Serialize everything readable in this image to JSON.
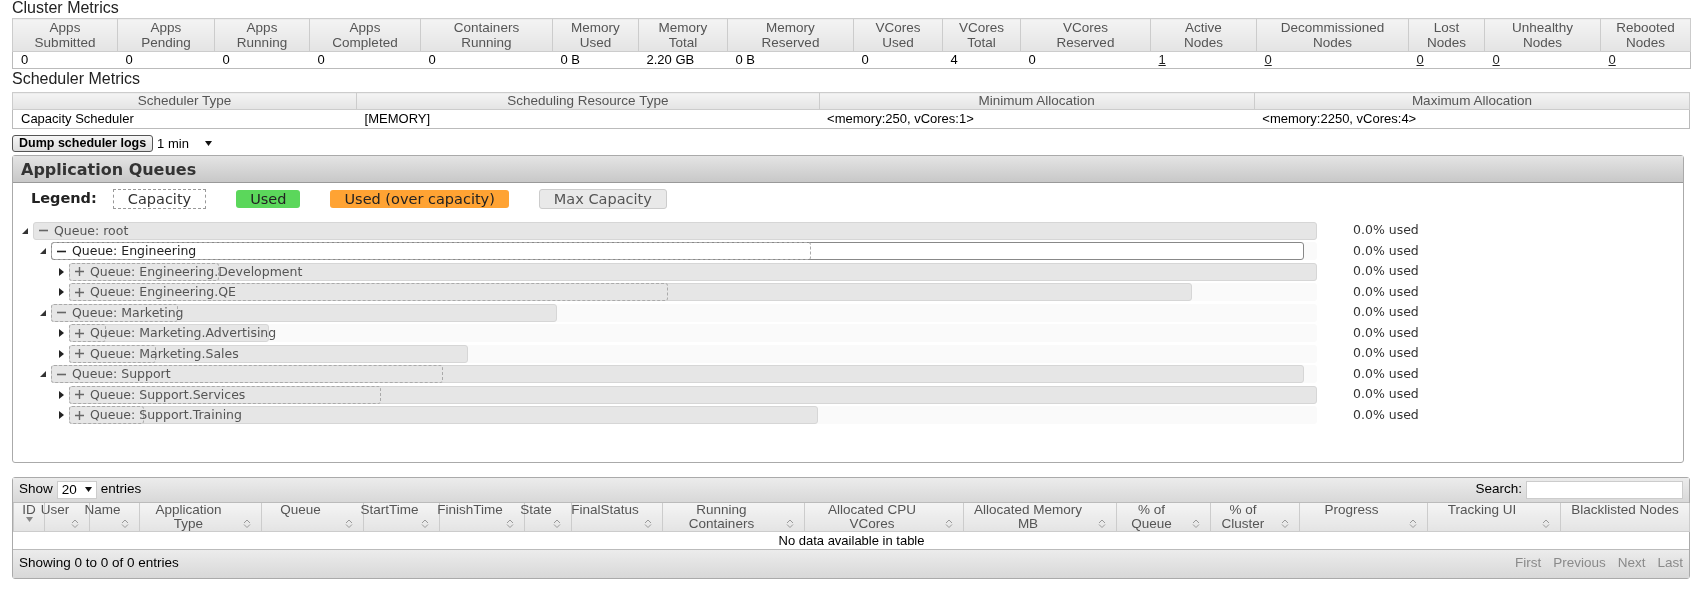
{
  "cluster_metrics": {
    "title": "Cluster Metrics",
    "columns": [
      {
        "label": "Apps Submitted",
        "value": "0",
        "link": false
      },
      {
        "label": "Apps Pending",
        "value": "0",
        "link": false
      },
      {
        "label": "Apps Running",
        "value": "0",
        "link": false
      },
      {
        "label": "Apps Completed",
        "value": "0",
        "link": false
      },
      {
        "label": "Containers Running",
        "value": "0",
        "link": false
      },
      {
        "label": "Memory Used",
        "value": "0 B",
        "link": false
      },
      {
        "label": "Memory Total",
        "value": "2.20 GB",
        "link": false
      },
      {
        "label": "Memory Reserved",
        "value": "0 B",
        "link": false
      },
      {
        "label": "VCores Used",
        "value": "0",
        "link": false
      },
      {
        "label": "VCores Total",
        "value": "4",
        "link": false
      },
      {
        "label": "VCores Reserved",
        "value": "0",
        "link": false
      },
      {
        "label": "Active Nodes",
        "value": "1",
        "link": true
      },
      {
        "label": "Decommissioned Nodes",
        "value": "0",
        "link": true
      },
      {
        "label": "Lost Nodes",
        "value": "0",
        "link": true
      },
      {
        "label": "Unhealthy Nodes",
        "value": "0",
        "link": true
      },
      {
        "label": "Rebooted Nodes",
        "value": "0",
        "link": true
      }
    ]
  },
  "scheduler_metrics": {
    "title": "Scheduler Metrics",
    "columns": [
      "Scheduler Type",
      "Scheduling Resource Type",
      "Minimum Allocation",
      "Maximum Allocation"
    ],
    "row": [
      "Capacity Scheduler",
      "[MEMORY]",
      "<memory:250, vCores:1>",
      "<memory:2250, vCores:4>"
    ]
  },
  "dump_button": "Dump scheduler logs",
  "dump_interval": "1 min",
  "application_queues": {
    "title": "Application Queues",
    "legend_label": "Legend:",
    "legend": [
      {
        "kind": "capacity",
        "label": "Capacity"
      },
      {
        "kind": "used",
        "label": "Used"
      },
      {
        "kind": "over",
        "label": "Used (over capacity)"
      },
      {
        "kind": "max",
        "label": "Max Capacity"
      }
    ],
    "queues": [
      {
        "label": "Queue: root",
        "usage": "0.0% used",
        "expanded": true,
        "selected": false,
        "max_capacity": {
          "level": 1.0
        },
        "children": [
          {
            "label": "Queue: Engineering",
            "usage": "0.0% used",
            "expanded": true,
            "selected": true,
            "max_capacity": {
              "level": 0.99
            },
            "capacity": {
              "level": 0.6
            },
            "children": [
              {
                "label": "Queue: Engineering.Development",
                "usage": "0.0% used",
                "expanded": false,
                "selected": false,
                "max_capacity": {
                  "level": 1.0
                },
                "capacity": {
                  "level": 0.12
                }
              },
              {
                "label": "Queue: Engineering.QE",
                "usage": "0.0% used",
                "expanded": false,
                "selected": false,
                "max_capacity": {
                  "level": 0.9
                },
                "capacity": {
                  "level": 0.48
                }
              }
            ]
          },
          {
            "label": "Queue: Marketing",
            "usage": "0.0% used",
            "expanded": true,
            "selected": false,
            "max_capacity": {
              "level": 0.4
            },
            "capacity": {
              "level": 0.1
            },
            "children": [
              {
                "label": "Queue: Marketing.Advertising",
                "usage": "0.0% used",
                "expanded": false,
                "selected": false,
                "max_capacity": {
                  "level": 0.16
                },
                "capacity": {
                  "level": 0.03
                }
              },
              {
                "label": "Queue: Marketing.Sales",
                "usage": "0.0% used",
                "expanded": false,
                "selected": false,
                "max_capacity": {
                  "level": 0.32
                },
                "capacity": {
                  "level": 0.07
                }
              }
            ]
          },
          {
            "label": "Queue: Support",
            "usage": "0.0% used",
            "expanded": true,
            "selected": false,
            "max_capacity": {
              "level": 0.99
            },
            "capacity": {
              "level": 0.31
            },
            "children": [
              {
                "label": "Queue: Support.Services",
                "usage": "0.0% used",
                "expanded": false,
                "selected": false,
                "max_capacity": {
                  "level": 1.0
                },
                "capacity": {
                  "level": 0.25
                }
              },
              {
                "label": "Queue: Support.Training",
                "usage": "0.0% used",
                "expanded": false,
                "selected": false,
                "max_capacity": {
                  "level": 0.6
                },
                "capacity": {
                  "level": 0.06
                }
              }
            ]
          }
        ]
      }
    ]
  },
  "applications": {
    "show_label": "Show",
    "page_size": "20",
    "entries_label": "entries",
    "search_label": "Search:",
    "columns": [
      {
        "label": "ID",
        "sortable": true,
        "sorted_descending": true
      },
      {
        "label": "User",
        "sortable": true,
        "sorted_descending": false
      },
      {
        "label": "Name",
        "sortable": true,
        "sorted_descending": false
      },
      {
        "label": "Application Type",
        "sortable": true,
        "sorted_descending": false
      },
      {
        "label": "Queue",
        "sortable": true,
        "sorted_descending": false
      },
      {
        "label": "StartTime",
        "sortable": true,
        "sorted_descending": false
      },
      {
        "label": "FinishTime",
        "sortable": true,
        "sorted_descending": false
      },
      {
        "label": "State",
        "sortable": true,
        "sorted_descending": false
      },
      {
        "label": "FinalStatus",
        "sortable": true,
        "sorted_descending": false
      },
      {
        "label": "Running Containers",
        "sortable": true,
        "sorted_descending": false
      },
      {
        "label": "Allocated CPU VCores",
        "sortable": true,
        "sorted_descending": false
      },
      {
        "label": "Allocated Memory MB",
        "sortable": true,
        "sorted_descending": false
      },
      {
        "label": "% of Queue",
        "sortable": true,
        "sorted_descending": false
      },
      {
        "label": "% of Cluster",
        "sortable": true,
        "sorted_descending": false
      },
      {
        "label": "Progress",
        "sortable": true,
        "sorted_descending": false
      },
      {
        "label": "Tracking UI",
        "sortable": true,
        "sorted_descending": false
      },
      {
        "label": "Blacklisted Nodes",
        "sortable": false,
        "sorted_descending": false
      }
    ],
    "empty_message": "No data available in table",
    "info": "Showing 0 to 0 of 0 entries",
    "pagination": [
      {
        "label": "First",
        "disabled": true
      },
      {
        "label": "Previous",
        "disabled": true
      },
      {
        "label": "Next",
        "disabled": true
      },
      {
        "label": "Last",
        "disabled": true
      }
    ]
  }
}
